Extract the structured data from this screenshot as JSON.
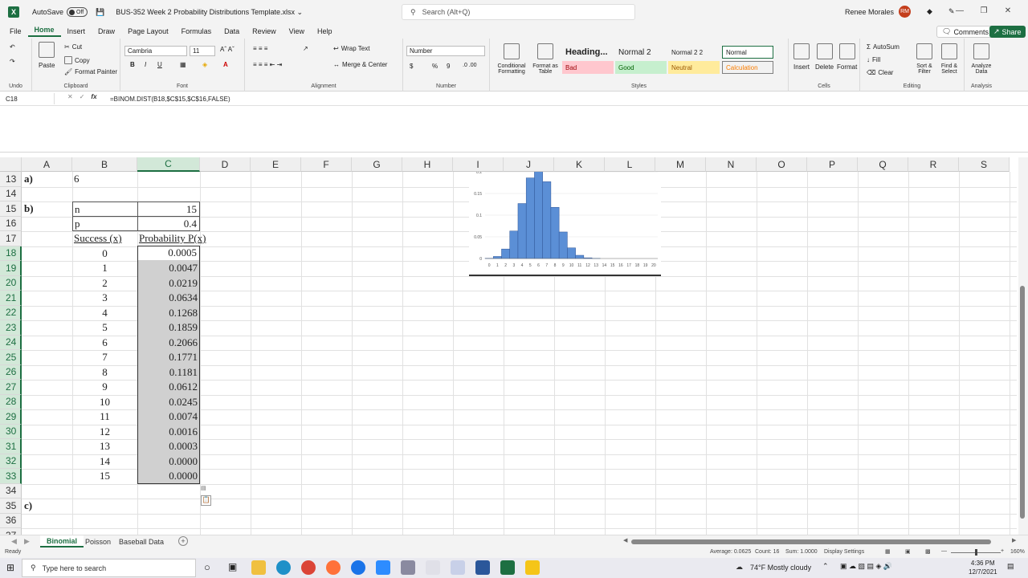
{
  "titlebar": {
    "autosave_label": "AutoSave",
    "autosave_state": "Off",
    "filename": "BUS-352 Week 2 Probability Distributions Template.xlsx",
    "search_placeholder": "Search (Alt+Q)",
    "user_name": "Renee Morales",
    "user_initials": "RM"
  },
  "menu": [
    "File",
    "Home",
    "Insert",
    "Draw",
    "Page Layout",
    "Formulas",
    "Data",
    "Review",
    "View",
    "Help"
  ],
  "menu_active": "Home",
  "comments_label": "Comments",
  "share_label": "Share",
  "ribbon": {
    "clipboard": {
      "paste": "Paste",
      "cut": "Cut",
      "copy": "Copy",
      "format_painter": "Format Painter",
      "label": "Clipboard"
    },
    "undo_label": "Undo",
    "font": {
      "name": "Cambria",
      "size": "11",
      "bold": "B",
      "italic": "I",
      "underline": "U",
      "label": "Font"
    },
    "alignment": {
      "wrap": "Wrap Text",
      "merge": "Merge & Center",
      "label": "Alignment"
    },
    "number": {
      "format": "Number",
      "label": "Number",
      "currency": "$",
      "percent": "%",
      "comma": "9"
    },
    "styles": {
      "conditional": "Conditional Formatting",
      "format_table": "Format as Table",
      "cells": [
        {
          "text": "Heading...",
          "bg": "#ffffff",
          "color": "#222222"
        },
        {
          "text": "Normal 2",
          "bg": "#ffffff",
          "color": "#222222"
        },
        {
          "text": "Normal 2 2",
          "bg": "#ffffff",
          "color": "#222222"
        },
        {
          "text": "Normal",
          "bg": "#ffffff",
          "color": "#222222"
        },
        {
          "text": "Bad",
          "bg": "#ffc7ce",
          "color": "#9c0006"
        },
        {
          "text": "Good",
          "bg": "#c6efce",
          "color": "#006100"
        },
        {
          "text": "Neutral",
          "bg": "#ffeb9c",
          "color": "#9c5700"
        },
        {
          "text": "Calculation",
          "bg": "#f2f2f2",
          "color": "#fa7d00"
        }
      ],
      "label": "Styles"
    },
    "cells": {
      "insert": "Insert",
      "delete": "Delete",
      "format": "Format",
      "label": "Cells"
    },
    "editing": {
      "autosum": "AutoSum",
      "fill": "Fill",
      "clear": "Clear",
      "sort": "Sort & Filter",
      "find": "Find & Select",
      "label": "Editing"
    },
    "analysis": {
      "analyze": "Analyze Data",
      "label": "Analysis"
    }
  },
  "formula_bar": {
    "name_box": "C18",
    "formula": "=BINOM.DIST(B18,$C$15,$C$16,FALSE)"
  },
  "columns": [
    "A",
    "B",
    "C",
    "D",
    "E",
    "F",
    "G",
    "H",
    "I",
    "J",
    "K",
    "L",
    "M",
    "N",
    "O",
    "P",
    "Q",
    "R",
    "S"
  ],
  "rows": [
    "13",
    "14",
    "15",
    "16",
    "17",
    "18",
    "19",
    "20",
    "21",
    "22",
    "23",
    "24",
    "25",
    "26",
    "27",
    "28",
    "29",
    "30",
    "31",
    "32",
    "33",
    "34",
    "35",
    "36",
    "37"
  ],
  "sheet": {
    "a_label": "a)",
    "a_value": "6",
    "b_label": "b)",
    "n_label": "n",
    "n_value": "15",
    "p_label": "p",
    "p_value": "0.4",
    "success_header": "Success (x)",
    "prob_header": "Probability P(x)",
    "table": [
      {
        "x": "0",
        "p": "0.0005"
      },
      {
        "x": "1",
        "p": "0.0047"
      },
      {
        "x": "2",
        "p": "0.0219"
      },
      {
        "x": "3",
        "p": "0.0634"
      },
      {
        "x": "4",
        "p": "0.1268"
      },
      {
        "x": "5",
        "p": "0.1859"
      },
      {
        "x": "6",
        "p": "0.2066"
      },
      {
        "x": "7",
        "p": "0.1771"
      },
      {
        "x": "8",
        "p": "0.1181"
      },
      {
        "x": "9",
        "p": "0.0612"
      },
      {
        "x": "10",
        "p": "0.0245"
      },
      {
        "x": "11",
        "p": "0.0074"
      },
      {
        "x": "12",
        "p": "0.0016"
      },
      {
        "x": "13",
        "p": "0.0003"
      },
      {
        "x": "14",
        "p": "0.0000"
      },
      {
        "x": "15",
        "p": "0.0000"
      }
    ],
    "c_label": "c)"
  },
  "chart_data": {
    "type": "bar",
    "categories": [
      "0",
      "1",
      "2",
      "3",
      "4",
      "5",
      "6",
      "7",
      "8",
      "9",
      "10",
      "11",
      "12",
      "13",
      "14",
      "15",
      "16",
      "17",
      "18",
      "19",
      "20"
    ],
    "values": [
      0.0005,
      0.0047,
      0.0219,
      0.0634,
      0.1268,
      0.1859,
      0.2066,
      0.1771,
      0.1181,
      0.0612,
      0.0245,
      0.0074,
      0.0016,
      0.0003,
      0,
      0,
      0,
      0,
      0,
      0,
      0
    ],
    "ytick_labels": [
      "0",
      "0.05",
      "0.1",
      "0.15",
      "0.2"
    ],
    "ylim": [
      0,
      0.2
    ],
    "bar_color": "#5b8fd6"
  },
  "sheet_tabs": [
    "Binomial",
    "Poisson",
    "Baseball Data"
  ],
  "sheet_active": "Binomial",
  "status": {
    "ready": "Ready",
    "average": "Average: 0.0625",
    "count": "Count: 16",
    "sum": "Sum: 1.0000",
    "display": "Display Settings",
    "zoom": "160%"
  },
  "taskbar": {
    "search_placeholder": "Type here to search",
    "weather": "74°F  Mostly cloudy",
    "time": "4:36 PM",
    "date": "12/7/2021"
  }
}
